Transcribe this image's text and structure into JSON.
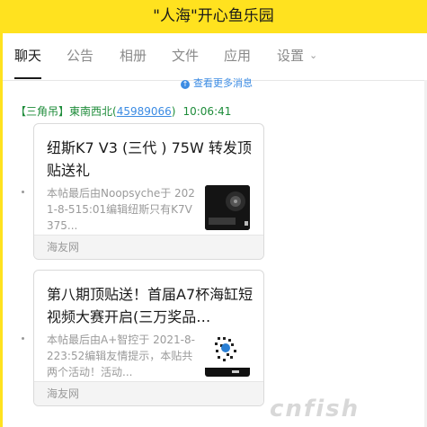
{
  "window": {
    "title": "\"人海\"开心鱼乐园"
  },
  "tabs": [
    {
      "label": "聊天",
      "active": true
    },
    {
      "label": "公告"
    },
    {
      "label": "相册"
    },
    {
      "label": "文件"
    },
    {
      "label": "应用"
    },
    {
      "label": "设置"
    }
  ],
  "history_link": {
    "icon": "up-arrow-circle-icon",
    "label": "查看更多消息"
  },
  "message": {
    "sender_tag": "【三角吊】",
    "sender_name": "東南西北",
    "sender_open": "(",
    "sender_id": "45989066",
    "sender_close": ")",
    "time": "10:06:41"
  },
  "cards": [
    {
      "title": "纽斯K7 V3 (三代 ) 75W 转发顶贴送礼",
      "description": "本帖最后由Noopsyche于 2021-8-515:01编辑纽斯只有K7V375...",
      "source": "海友网"
    },
    {
      "title": "第八期顶贴送！首届A7杯海缸短视频大赛开启(三万奖品…",
      "description": "本帖最后由A+智控于 2021-8-223:52编辑友情提示，本贴共两个活动！活动...",
      "source": "海友网"
    }
  ],
  "watermark": {
    "text": "cnfish"
  },
  "colors": {
    "titlebar_bg": "#ffe21f",
    "link_blue": "#3b8be3",
    "sender_green": "#1e8c3a"
  }
}
